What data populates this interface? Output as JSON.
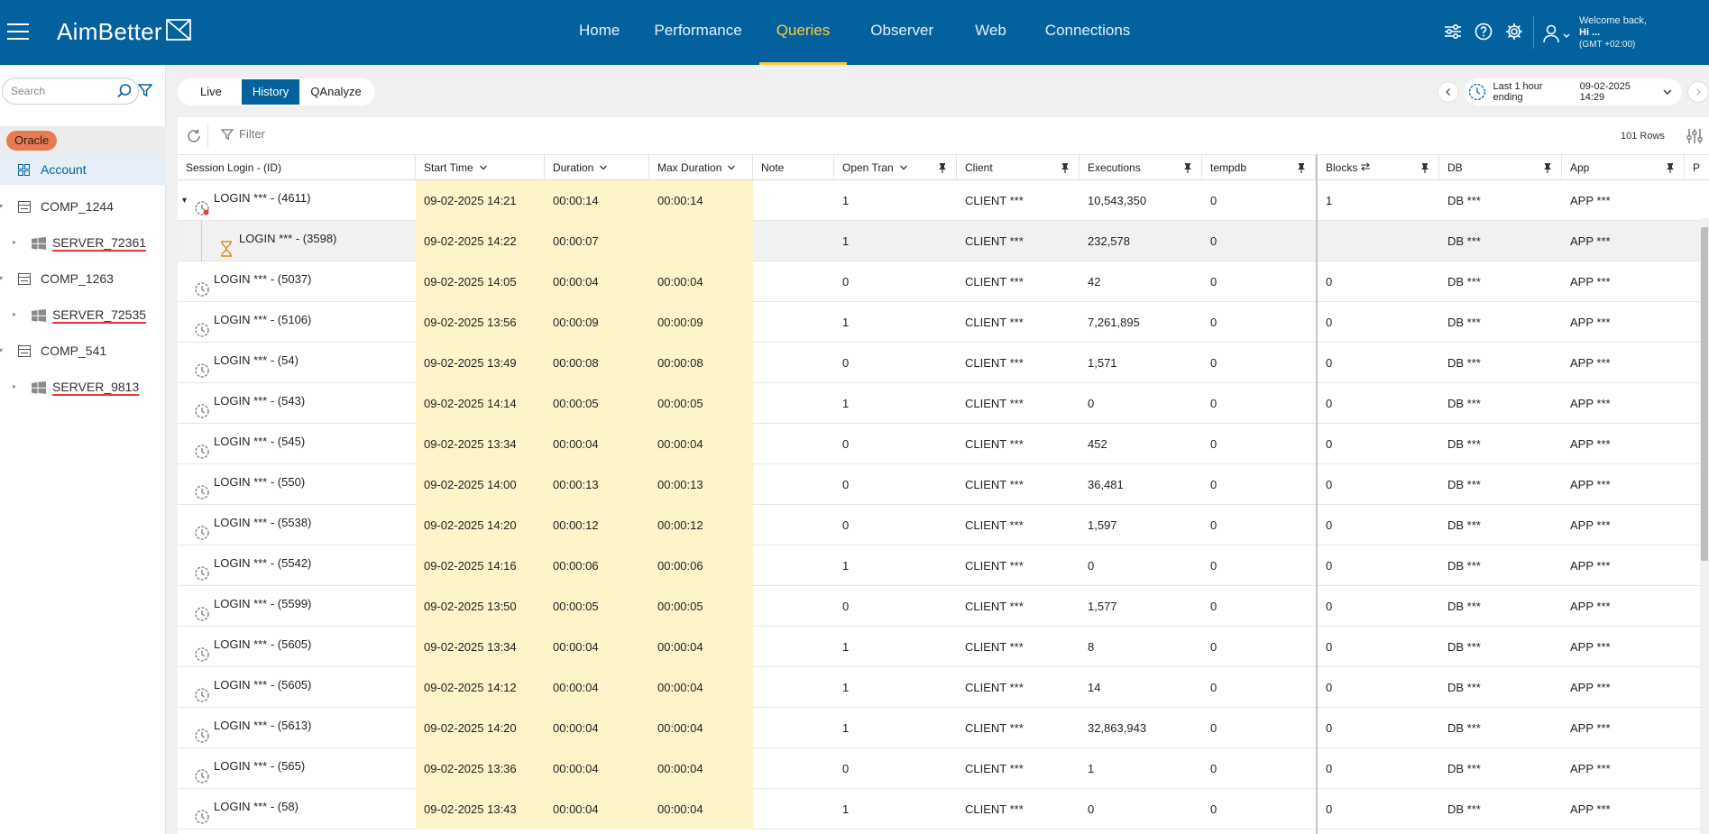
{
  "app": {
    "name": "AimBetter",
    "nav": [
      "Home",
      "Performance",
      "Queries",
      "Observer",
      "Web",
      "Connections"
    ],
    "active_nav": "Queries",
    "user": {
      "welcome": "Welcome back,",
      "name": "Hi ...",
      "timezone": "(GMT +02:00)"
    }
  },
  "sidebar": {
    "search_placeholder": "Search",
    "db_type": "Oracle",
    "account_label": "Account",
    "tree": [
      {
        "type": "computer",
        "label": "COMP_1244"
      },
      {
        "type": "server",
        "label": "SERVER_72361"
      },
      {
        "type": "computer",
        "label": "COMP_1263"
      },
      {
        "type": "server",
        "label": "SERVER_72535"
      },
      {
        "type": "computer",
        "label": "COMP_541"
      },
      {
        "type": "server",
        "label": "SERVER_9813"
      }
    ]
  },
  "main": {
    "tabs": [
      "Live",
      "History",
      "QAnalyze"
    ],
    "active_tab": "History",
    "time_range_label": "Last 1 hour ending",
    "time_range_value": "09-02-2025 14:29",
    "filter_placeholder": "Filter",
    "rows_count": "101 Rows"
  },
  "table": {
    "columns": [
      "Session Login - (ID)",
      "Start Time",
      "Duration",
      "Max Duration",
      "Note",
      "Open Tran",
      "Client",
      "Executions",
      "tempdb",
      "Blocks",
      "DB",
      "App",
      "P"
    ],
    "rows": [
      {
        "session": "LOGIN *** - (4611)",
        "start": "09-02-2025 14:21",
        "duration": "00:00:14",
        "max": "00:00:14",
        "note": "",
        "open": "1",
        "client": "CLIENT ***",
        "exec": "10,543,350",
        "tempdb": "0",
        "blocks": "1",
        "db": "DB ***",
        "app": "APP ***",
        "kind": "parent",
        "icon": "session-blocking-icon"
      },
      {
        "session": "LOGIN *** - (3598)",
        "start": "09-02-2025 14:22",
        "duration": "00:00:07",
        "max": "",
        "note": "",
        "open": "1",
        "client": "CLIENT ***",
        "exec": "232,578",
        "tempdb": "0",
        "blocks": "",
        "db": "DB ***",
        "app": "APP ***",
        "kind": "child",
        "icon": "hourglass-icon"
      },
      {
        "session": "LOGIN *** - (5037)",
        "start": "09-02-2025 14:05",
        "duration": "00:00:04",
        "max": "00:00:04",
        "note": "",
        "open": "0",
        "client": "CLIENT ***",
        "exec": "42",
        "tempdb": "0",
        "blocks": "0",
        "db": "DB ***",
        "app": "APP ***",
        "kind": "normal",
        "icon": "session-icon"
      },
      {
        "session": "LOGIN *** - (5106)",
        "start": "09-02-2025 13:56",
        "duration": "00:00:09",
        "max": "00:00:09",
        "note": "",
        "open": "1",
        "client": "CLIENT ***",
        "exec": "7,261,895",
        "tempdb": "0",
        "blocks": "0",
        "db": "DB ***",
        "app": "APP ***",
        "kind": "normal",
        "icon": "session-icon"
      },
      {
        "session": "LOGIN *** - (54)",
        "start": "09-02-2025 13:49",
        "duration": "00:00:08",
        "max": "00:00:08",
        "note": "",
        "open": "0",
        "client": "CLIENT ***",
        "exec": "1,571",
        "tempdb": "0",
        "blocks": "0",
        "db": "DB ***",
        "app": "APP ***",
        "kind": "normal",
        "icon": "session-icon"
      },
      {
        "session": "LOGIN *** - (543)",
        "start": "09-02-2025 14:14",
        "duration": "00:00:05",
        "max": "00:00:05",
        "note": "",
        "open": "1",
        "client": "CLIENT ***",
        "exec": "0",
        "tempdb": "0",
        "blocks": "0",
        "db": "DB ***",
        "app": "APP ***",
        "kind": "normal",
        "icon": "session-icon"
      },
      {
        "session": "LOGIN *** - (545)",
        "start": "09-02-2025 13:34",
        "duration": "00:00:04",
        "max": "00:00:04",
        "note": "",
        "open": "0",
        "client": "CLIENT ***",
        "exec": "452",
        "tempdb": "0",
        "blocks": "0",
        "db": "DB ***",
        "app": "APP ***",
        "kind": "normal",
        "icon": "session-icon"
      },
      {
        "session": "LOGIN *** - (550)",
        "start": "09-02-2025 14:00",
        "duration": "00:00:13",
        "max": "00:00:13",
        "note": "",
        "open": "0",
        "client": "CLIENT ***",
        "exec": "36,481",
        "tempdb": "0",
        "blocks": "0",
        "db": "DB ***",
        "app": "APP ***",
        "kind": "normal",
        "icon": "session-icon"
      },
      {
        "session": "LOGIN *** - (5538)",
        "start": "09-02-2025 14:20",
        "duration": "00:00:12",
        "max": "00:00:12",
        "note": "",
        "open": "0",
        "client": "CLIENT ***",
        "exec": "1,597",
        "tempdb": "0",
        "blocks": "0",
        "db": "DB ***",
        "app": "APP ***",
        "kind": "normal",
        "icon": "session-icon"
      },
      {
        "session": "LOGIN *** - (5542)",
        "start": "09-02-2025 14:16",
        "duration": "00:00:06",
        "max": "00:00:06",
        "note": "",
        "open": "1",
        "client": "CLIENT ***",
        "exec": "0",
        "tempdb": "0",
        "blocks": "0",
        "db": "DB ***",
        "app": "APP ***",
        "kind": "normal",
        "icon": "session-icon"
      },
      {
        "session": "LOGIN *** - (5599)",
        "start": "09-02-2025 13:50",
        "duration": "00:00:05",
        "max": "00:00:05",
        "note": "",
        "open": "0",
        "client": "CLIENT ***",
        "exec": "1,577",
        "tempdb": "0",
        "blocks": "0",
        "db": "DB ***",
        "app": "APP ***",
        "kind": "normal",
        "icon": "session-icon"
      },
      {
        "session": "LOGIN *** - (5605)",
        "start": "09-02-2025 13:34",
        "duration": "00:00:04",
        "max": "00:00:04",
        "note": "",
        "open": "1",
        "client": "CLIENT ***",
        "exec": "8",
        "tempdb": "0",
        "blocks": "0",
        "db": "DB ***",
        "app": "APP ***",
        "kind": "normal",
        "icon": "session-icon"
      },
      {
        "session": "LOGIN *** - (5605)",
        "start": "09-02-2025 14:12",
        "duration": "00:00:04",
        "max": "00:00:04",
        "note": "",
        "open": "1",
        "client": "CLIENT ***",
        "exec": "14",
        "tempdb": "0",
        "blocks": "0",
        "db": "DB ***",
        "app": "APP ***",
        "kind": "normal",
        "icon": "session-icon"
      },
      {
        "session": "LOGIN *** - (5613)",
        "start": "09-02-2025 14:20",
        "duration": "00:00:04",
        "max": "00:00:04",
        "note": "",
        "open": "1",
        "client": "CLIENT ***",
        "exec": "32,863,943",
        "tempdb": "0",
        "blocks": "0",
        "db": "DB ***",
        "app": "APP ***",
        "kind": "normal",
        "icon": "session-icon"
      },
      {
        "session": "LOGIN *** - (565)",
        "start": "09-02-2025 13:36",
        "duration": "00:00:04",
        "max": "00:00:04",
        "note": "",
        "open": "0",
        "client": "CLIENT ***",
        "exec": "1",
        "tempdb": "0",
        "blocks": "0",
        "db": "DB ***",
        "app": "APP ***",
        "kind": "normal",
        "icon": "session-icon"
      },
      {
        "session": "LOGIN *** - (58)",
        "start": "09-02-2025 13:43",
        "duration": "00:00:04",
        "max": "00:00:04",
        "note": "",
        "open": "1",
        "client": "CLIENT ***",
        "exec": "0",
        "tempdb": "0",
        "blocks": "0",
        "db": "DB ***",
        "app": "APP ***",
        "kind": "normal",
        "icon": "session-icon"
      }
    ]
  },
  "colors": {
    "header": "#03629e",
    "accent": "#fbcb3c",
    "oracle": "#ea7a52",
    "highlight": "#fdf4c9"
  }
}
